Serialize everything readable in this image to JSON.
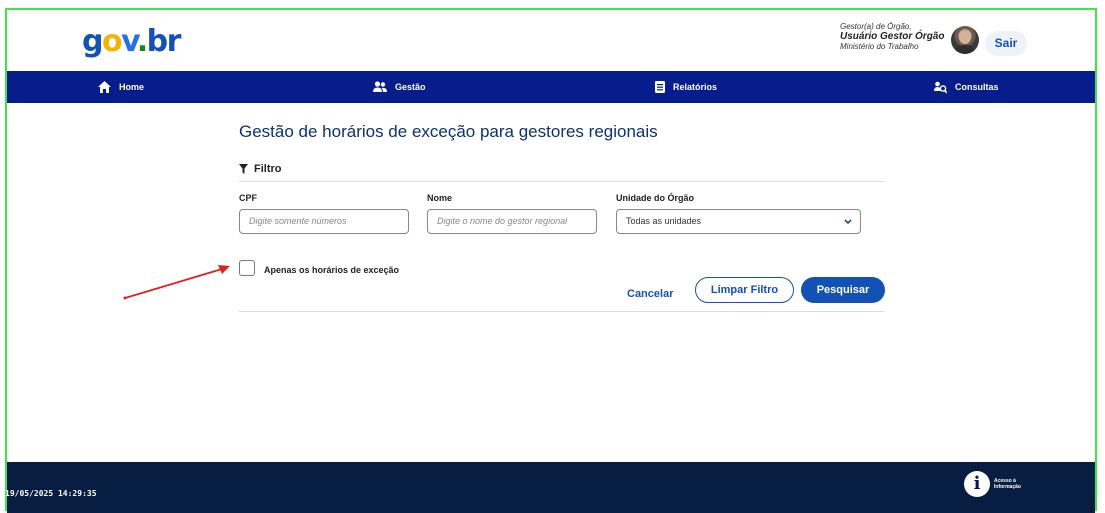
{
  "header": {
    "logo": {
      "g": "g",
      "o": "o",
      "v": "v",
      "dot": ".",
      "br": "br"
    },
    "user": {
      "role": "Gestor(a) de Órgão,",
      "name": "Usuário Gestor Órgão",
      "org": "Ministério do Trabalho"
    },
    "sair_label": "Sair"
  },
  "nav": {
    "items": [
      {
        "label": "Home",
        "icon": "home-icon"
      },
      {
        "label": "Gestão",
        "icon": "users-icon"
      },
      {
        "label": "Relatórios",
        "icon": "document-icon"
      },
      {
        "label": "Consultas",
        "icon": "search-users-icon"
      }
    ]
  },
  "main": {
    "title": "Gestão de horários de exceção para gestores regionais",
    "filter_label": "Filtro",
    "fields": {
      "cpf": {
        "label": "CPF",
        "placeholder": "Digite somente números"
      },
      "nome": {
        "label": "Nome",
        "placeholder": "Digite o nome do gestor regional"
      },
      "unidade": {
        "label": "Unidade do Órgão",
        "value": "Todas as unidades"
      }
    },
    "checkbox_label": "Apenas os horários de exceção",
    "buttons": {
      "cancelar": "Cancelar",
      "limpar": "Limpar Filtro",
      "pesquisar": "Pesquisar"
    }
  },
  "footer": {
    "timestamp": "19/05/2025 14:29:35",
    "acesso_label": "Acesso à Informação",
    "acesso_icon_letter": "i"
  },
  "colors": {
    "primary": "#1351b4",
    "nav": "#071d8c",
    "footer": "#071d41",
    "title": "#0c326f",
    "annotation_arrow": "#e02020"
  }
}
